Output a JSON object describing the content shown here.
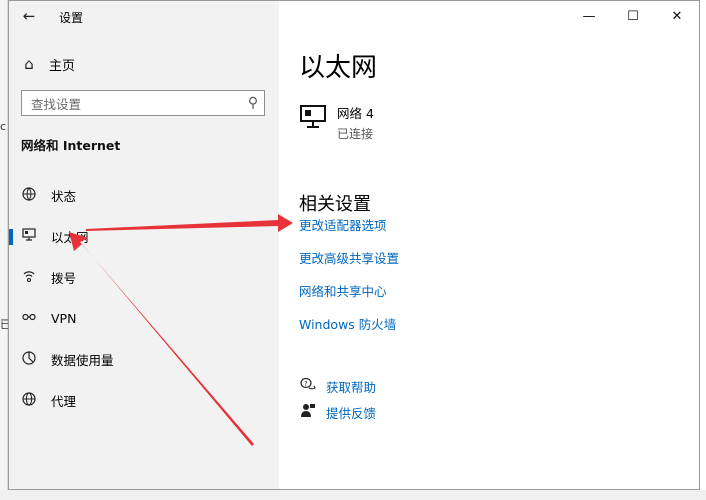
{
  "window": {
    "title": "设置",
    "back_icon": "arrow-left-icon",
    "caption": {
      "minimize": "—",
      "maximize": "☐",
      "close": "✕"
    }
  },
  "sidebar": {
    "home_label": "主页",
    "search_placeholder": "查找设置",
    "section_title": "网络和 Internet",
    "items": [
      {
        "label": "状态",
        "icon": "globe-status-icon"
      },
      {
        "label": "以太网",
        "icon": "ethernet-icon",
        "selected": true
      },
      {
        "label": "拨号",
        "icon": "dialup-icon"
      },
      {
        "label": "VPN",
        "icon": "vpn-icon"
      },
      {
        "label": "数据使用量",
        "icon": "data-usage-icon"
      },
      {
        "label": "代理",
        "icon": "proxy-globe-icon"
      }
    ]
  },
  "main": {
    "title": "以太网",
    "network": {
      "name": "网络 4",
      "status": "已连接"
    },
    "related_title": "相关设置",
    "links": [
      "更改适配器选项",
      "更改高级共享设置",
      "网络和共享中心",
      "Windows 防火墙"
    ],
    "help": [
      {
        "label": "获取帮助",
        "icon": "help-chat-icon"
      },
      {
        "label": "提供反馈",
        "icon": "feedback-icon"
      }
    ]
  },
  "colors": {
    "accent": "#0067c0",
    "annotation": "#e8323a",
    "sidebar_bg": "#f2f2f2"
  },
  "background_fragments": [
    "c",
    "已"
  ]
}
